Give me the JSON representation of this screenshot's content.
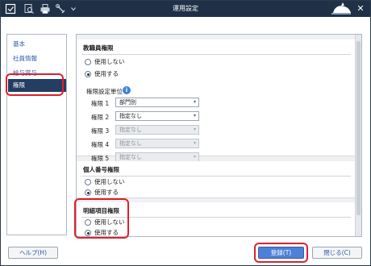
{
  "window": {
    "title": "運用設定",
    "close_glyph": "✕"
  },
  "toolbar": {
    "icons": [
      "app-icon",
      "search-icon",
      "print-icon",
      "tools-icon",
      "dropdown-icon"
    ]
  },
  "sidebar": {
    "items": [
      {
        "label": "基本"
      },
      {
        "label": "社員情報"
      },
      {
        "label": "給与賞与"
      },
      {
        "label": "権限"
      }
    ],
    "active_index": 3
  },
  "sections": {
    "teacher_perm": {
      "title": "教職員権限",
      "options": [
        "使用しない",
        "使用する"
      ],
      "selected": 1,
      "unit_label": "権限設定単位",
      "rows": [
        {
          "label": "権限 1",
          "value": "部門別",
          "disabled": false
        },
        {
          "label": "権限 2",
          "value": "指定なし",
          "disabled": false
        },
        {
          "label": "権限 3",
          "value": "指定なし",
          "disabled": true
        },
        {
          "label": "権限 4",
          "value": "指定なし",
          "disabled": true
        },
        {
          "label": "権限 5",
          "value": "指定なし",
          "disabled": true
        }
      ]
    },
    "personal_number": {
      "title": "個人番号権限",
      "options": [
        "使用しない",
        "使用する"
      ],
      "selected": 1
    },
    "detail_items": {
      "title": "明細項目権限",
      "options": [
        "使用しない",
        "使用する"
      ],
      "selected": 1
    }
  },
  "footer": {
    "help_label": "ヘルプ(H)",
    "register_label": "登録(T)",
    "close_label": "閉じる(C)"
  },
  "colors": {
    "titlebar": "#1f3047",
    "sidebar_active": "#233e62",
    "primary_button": "#4f80d8",
    "highlight": "#e0202b",
    "link_text": "#2b59a8"
  }
}
